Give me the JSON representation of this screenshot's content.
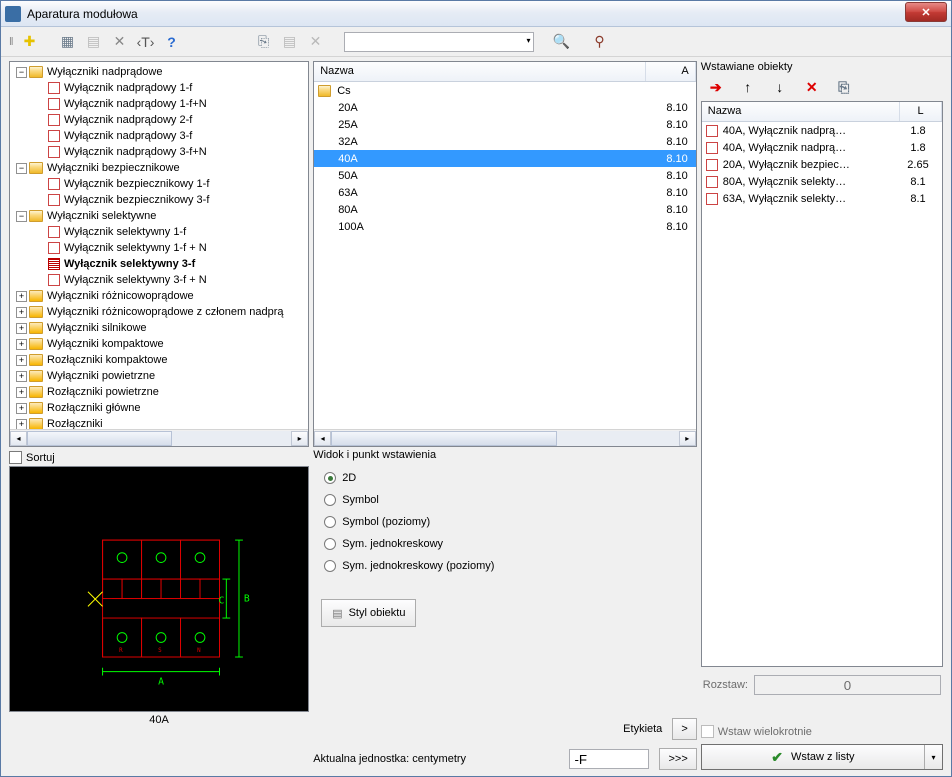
{
  "window": {
    "title": "Aparatura modułowa"
  },
  "toolbar": {
    "add": "✚",
    "grid": "▦",
    "list": "▤",
    "tools": "✕",
    "text": "‹T›",
    "help": "?",
    "copy": "⎘",
    "paste": "▤",
    "delete": "✕",
    "search": "🔍",
    "find": "⚲"
  },
  "tree": {
    "nodes": [
      {
        "level": 0,
        "type": "folder",
        "exp": "-",
        "open": true,
        "label": "Wyłączniki nadprądowe"
      },
      {
        "level": 1,
        "type": "leaf",
        "label": "Wyłącznik nadprądowy 1-f"
      },
      {
        "level": 1,
        "type": "leaf",
        "label": "Wyłącznik nadprądowy 1-f+N"
      },
      {
        "level": 1,
        "type": "leaf",
        "label": "Wyłącznik nadprądowy 2-f"
      },
      {
        "level": 1,
        "type": "leaf",
        "label": "Wyłącznik nadprądowy 3-f"
      },
      {
        "level": 1,
        "type": "leaf",
        "label": "Wyłącznik nadprądowy 3-f+N"
      },
      {
        "level": 0,
        "type": "folder",
        "exp": "-",
        "open": true,
        "label": "Wyłączniki bezpiecznikowe"
      },
      {
        "level": 1,
        "type": "leaf",
        "label": "Wyłącznik bezpiecznikowy 1-f"
      },
      {
        "level": 1,
        "type": "leaf",
        "label": "Wyłącznik bezpiecznikowy 3-f"
      },
      {
        "level": 0,
        "type": "folder",
        "exp": "-",
        "open": true,
        "label": "Wyłączniki selektywne"
      },
      {
        "level": 1,
        "type": "leaf",
        "label": "Wyłącznik selektywny 1-f"
      },
      {
        "level": 1,
        "type": "leaf",
        "label": "Wyłącznik selektywny 1-f + N"
      },
      {
        "level": 1,
        "type": "leaf",
        "sel": true,
        "bold": true,
        "label": "Wyłącznik selektywny 3-f"
      },
      {
        "level": 1,
        "type": "leaf",
        "label": "Wyłącznik selektywny 3-f + N"
      },
      {
        "level": 0,
        "type": "folder",
        "exp": "+",
        "label": "Wyłączniki różnicowoprądowe"
      },
      {
        "level": 0,
        "type": "folder",
        "exp": "+",
        "label": "Wyłączniki różnicowoprądowe z członem nadprą"
      },
      {
        "level": 0,
        "type": "folder",
        "exp": "+",
        "label": "Wyłączniki silnikowe"
      },
      {
        "level": 0,
        "type": "folder",
        "exp": "+",
        "label": "Wyłączniki kompaktowe"
      },
      {
        "level": 0,
        "type": "folder",
        "exp": "+",
        "label": "Rozłączniki kompaktowe"
      },
      {
        "level": 0,
        "type": "folder",
        "exp": "+",
        "label": "Wyłączniki powietrzne"
      },
      {
        "level": 0,
        "type": "folder",
        "exp": "+",
        "label": "Rozłączniki powietrzne"
      },
      {
        "level": 0,
        "type": "folder",
        "exp": "+",
        "label": "Rozłączniki główne"
      },
      {
        "level": 0,
        "type": "folder",
        "exp": "+",
        "label": "Rozłączniki"
      }
    ]
  },
  "list": {
    "header_name": "Nazwa",
    "header_a": "A",
    "folder": "Cs",
    "rows": [
      {
        "name": "20A",
        "a": "8.10"
      },
      {
        "name": "25A",
        "a": "8.10"
      },
      {
        "name": "32A",
        "a": "8.10"
      },
      {
        "name": "40A",
        "a": "8.10",
        "selected": true
      },
      {
        "name": "50A",
        "a": "8.10"
      },
      {
        "name": "63A",
        "a": "8.10"
      },
      {
        "name": "80A",
        "a": "8.10"
      },
      {
        "name": "100A",
        "a": "8.10"
      }
    ]
  },
  "objects": {
    "header": "Wstawiane obiekty",
    "col_name": "Nazwa",
    "col_l": "L",
    "rows": [
      {
        "name": "40A, Wyłącznik nadprą…",
        "l": "1.8"
      },
      {
        "name": "40A, Wyłącznik nadprą…",
        "l": "1.8"
      },
      {
        "name": "20A, Wyłącznik bezpiec…",
        "l": "2.65"
      },
      {
        "name": "80A, Wyłącznik selekty…",
        "l": "8.1"
      },
      {
        "name": "63A, Wyłącznik selekty…",
        "l": "8.1"
      }
    ],
    "rozstaw_label": "Rozstaw:",
    "rozstaw_value": "0"
  },
  "sortuj": "Sortuj",
  "preview_caption": "40A",
  "view": {
    "group_label": "Widok i punkt wstawienia",
    "options": [
      "2D",
      "Symbol",
      "Symbol (poziomy)",
      "Sym. jednokreskowy",
      "Sym. jednokreskowy (poziomy)"
    ],
    "selected": 0,
    "styl_label": "Styl obiektu"
  },
  "etykieta": {
    "label": "Etykieta",
    "btn": ">",
    "units_label": "Aktualna jednostka: centymetry",
    "value": "-F",
    "more": ">>>"
  },
  "wstaw": {
    "wiel_label": "Wstaw wielokrotnie",
    "main_label": "Wstaw z listy"
  }
}
